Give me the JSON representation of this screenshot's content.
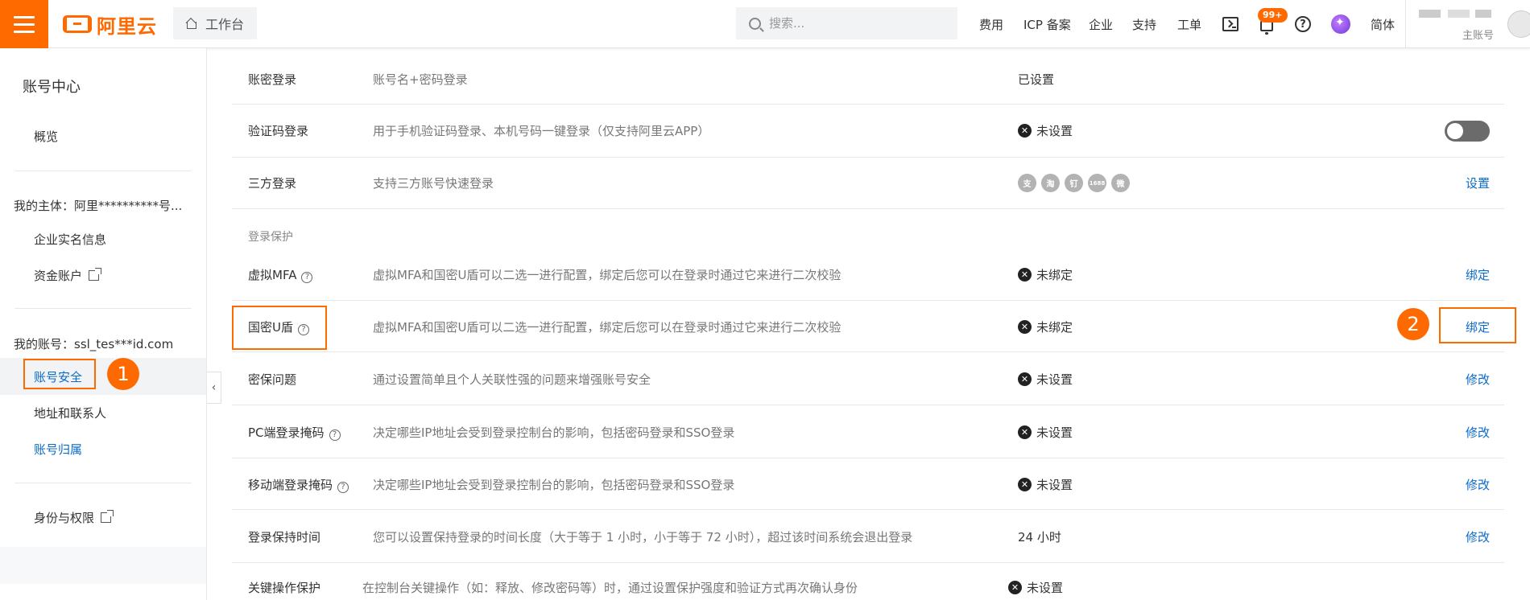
{
  "header": {
    "logo_text": "阿里云",
    "workbench_label": "工作台",
    "search_placeholder": "搜索...",
    "nav": [
      "费用",
      "ICP 备案",
      "企业",
      "支持",
      "工单"
    ],
    "badge": "99+",
    "lang": "简体",
    "user_role": "主账号",
    "accent_color": "#ff6a00"
  },
  "sidebar": {
    "title": "账号中心",
    "overview": "概览",
    "entity_label": "我的主体：阿里**********号...",
    "enterprise_info": "企业实名信息",
    "fund_account": "资金账户",
    "account_label": "我的账号：ssl_tes***id.com",
    "account_security": "账号安全",
    "address_contacts": "地址和联系人",
    "account_owner": "账号归属",
    "identity_perm": "身份与权限",
    "step1": "1"
  },
  "main": {
    "section_login_protection": "登录保护",
    "step2": "2",
    "rows": [
      {
        "name": "账密登录",
        "desc": "账号名+密码登录",
        "status": "已设置",
        "action": ""
      },
      {
        "name": "验证码登录",
        "desc": "用于手机验证码登录、本机号码一键登录（仅支持阿里云APP）",
        "status": "未设置",
        "action": ""
      },
      {
        "name": "三方登录",
        "desc": "支持三方账号快速登录",
        "status": "",
        "action": "设置"
      },
      {
        "name": "虚拟MFA",
        "desc": "虚拟MFA和国密U盾可以二选一进行配置，绑定后您可以在登录时通过它来进行二次校验",
        "status": "未绑定",
        "action": "绑定"
      },
      {
        "name": "国密U盾",
        "desc": "虚拟MFA和国密U盾可以二选一进行配置，绑定后您可以在登录时通过它来进行二次校验",
        "status": "未绑定",
        "action": "绑定"
      },
      {
        "name": "密保问题",
        "desc": "通过设置简单且个人关联性强的问题来增强账号安全",
        "status": "未设置",
        "action": "修改"
      },
      {
        "name": "PC端登录掩码",
        "desc": "决定哪些IP地址会受到登录控制台的影响，包括密码登录和SSO登录",
        "status": "未设置",
        "action": "修改"
      },
      {
        "name": "移动端登录掩码",
        "desc": "决定哪些IP地址会受到登录控制台的影响，包括密码登录和SSO登录",
        "status": "未设置",
        "action": "修改"
      },
      {
        "name": "登录保持时间",
        "desc": "您可以设置保持登录的时间长度（大于等于 1 小时，小于等于 72 小时），超过该时间系统会退出登录",
        "status": "24 小时",
        "action": "修改"
      },
      {
        "name": "关键操作保护",
        "desc": "在控制台关键操作（如：释放、修改密码等）时，通过设置保护强度和验证方式再次确认身份",
        "status": "未设置",
        "action": ""
      }
    ],
    "social_icons": [
      "支",
      "淘",
      "钉",
      "1688",
      "微"
    ]
  }
}
